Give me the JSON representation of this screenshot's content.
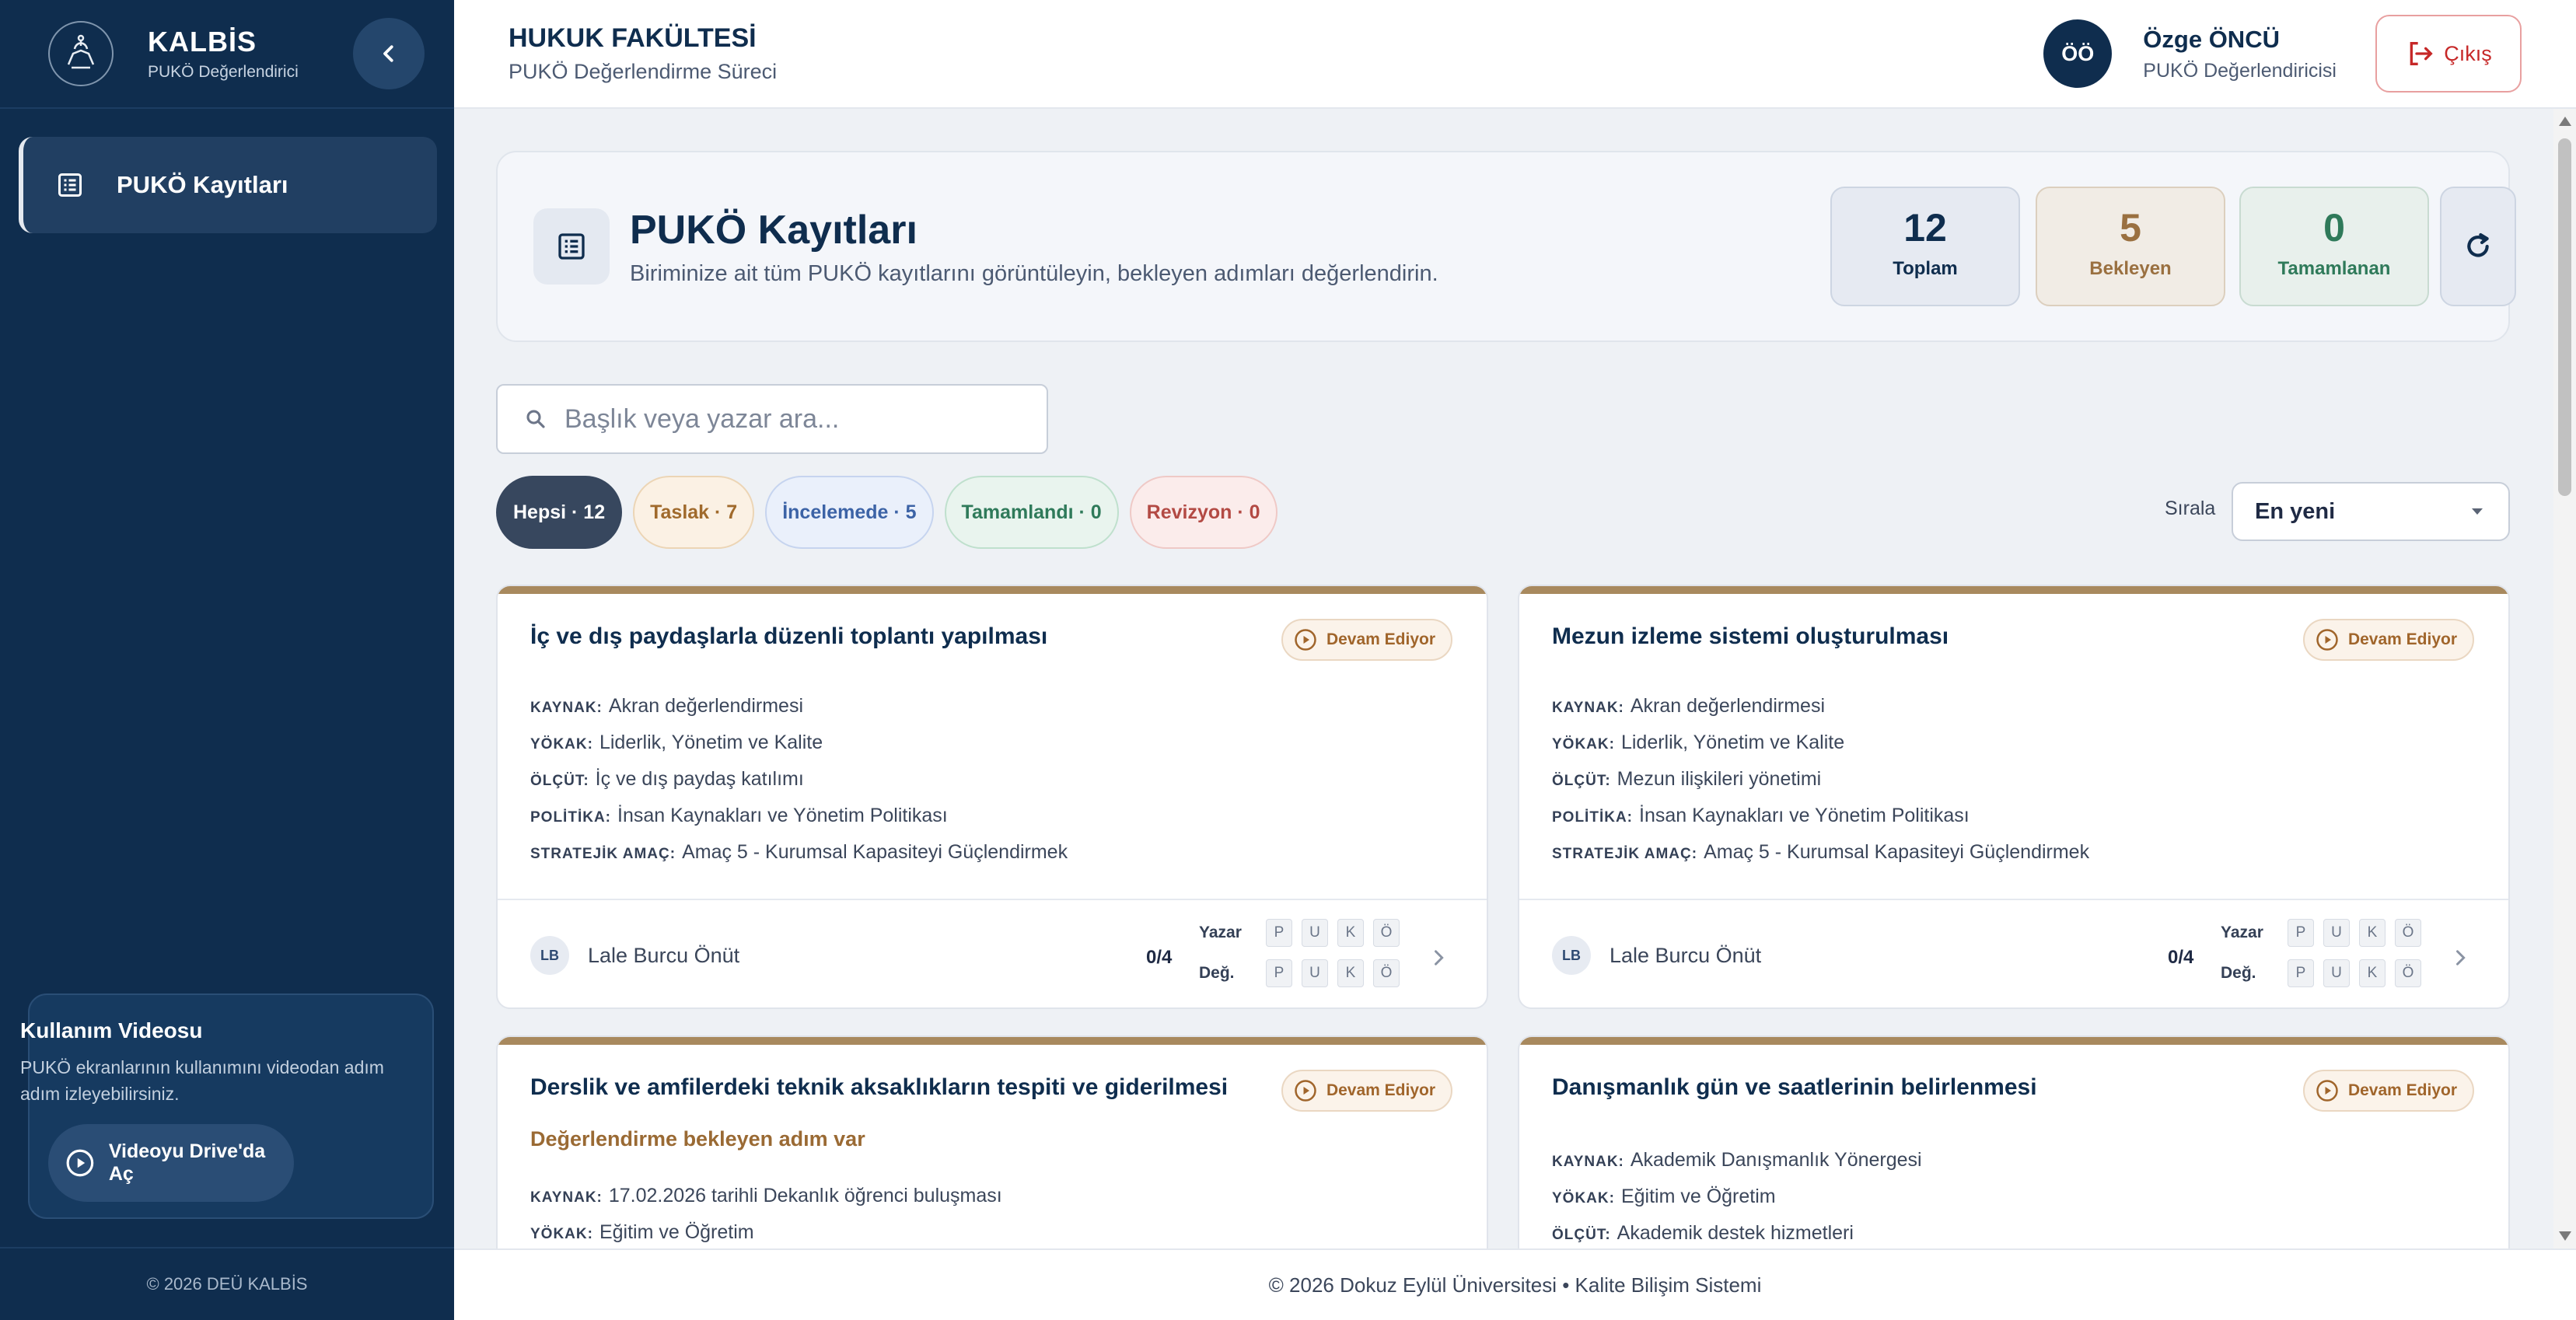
{
  "sidebar": {
    "brand_title": "KALBİS",
    "brand_sub": "PUKÖ Değerlendirici",
    "nav": [
      {
        "label": "PUKÖ Kayıtları",
        "icon": "list-icon"
      }
    ],
    "video": {
      "title": "Kullanım Videosu",
      "desc": "PUKÖ ekranlarının kullanımını videodan adım adım izleyebilirsiniz.",
      "button": "Videoyu Drive'da Aç"
    },
    "footer": "© 2026 DEÜ KALBİS"
  },
  "header": {
    "faculty": "HUKUK FAKÜLTESİ",
    "subtitle": "PUKÖ Değerlendirme Süreci",
    "user_initials": "ÖÖ",
    "user_name": "Özge ÖNCÜ",
    "user_role": "PUKÖ Değerlendiricisi",
    "logout": "Çıkış"
  },
  "hero": {
    "title": "PUKÖ Kayıtları",
    "desc": "Biriminize ait tüm PUKÖ kayıtlarını görüntüleyin, bekleyen adımları değerlendirin.",
    "stats": {
      "total": {
        "value": "12",
        "label": "Toplam"
      },
      "pending": {
        "value": "5",
        "label": "Bekleyen"
      },
      "done": {
        "value": "0",
        "label": "Tamamlanan"
      }
    }
  },
  "search": {
    "placeholder": "Başlık veya yazar ara..."
  },
  "filters": [
    "Hepsi · 12",
    "Taslak · 7",
    "İncelemede · 5",
    "Tamamlandı · 0",
    "Revizyon · 0"
  ],
  "sort": {
    "label": "Sırala",
    "value": "En yeni"
  },
  "meta_labels": {
    "source": "KAYNAK:",
    "yokak": "YÖKAK:",
    "criterion": "ÖLÇÜT:",
    "policy": "POLİTİKA:",
    "goal": "STRATEJİK AMAÇ:"
  },
  "cards": [
    {
      "title": "İç ve dış paydaşlarla düzenli toplantı yapılması",
      "status": "Devam Ediyor",
      "source": "Akran değerlendirmesi",
      "yokak": "Liderlik, Yönetim ve Kalite",
      "criterion": "İç ve dış paydaş katılımı",
      "policy": "İnsan Kaynakları ve Yönetim Politikası",
      "goal": "Amaç 5 - Kurumsal Kapasiteyi Güçlendirmek",
      "author_initials": "LB",
      "author": "Lale Burcu Önüt",
      "progress": "0/4"
    },
    {
      "title": "Mezun izleme sistemi oluşturulması",
      "status": "Devam Ediyor",
      "source": "Akran değerlendirmesi",
      "yokak": "Liderlik, Yönetim ve Kalite",
      "criterion": "Mezun ilişkileri yönetimi",
      "policy": "İnsan Kaynakları ve Yönetim Politikası",
      "goal": "Amaç 5 - Kurumsal Kapasiteyi Güçlendirmek",
      "author_initials": "LB",
      "author": "Lale Burcu Önüt",
      "progress": "0/4"
    },
    {
      "title": "Derslik ve amfilerdeki teknik aksaklıkların tespiti ve giderilmesi",
      "status": "Devam Ediyor",
      "pending_note": "Değerlendirme bekleyen adım var",
      "source": "17.02.2026 tarihli Dekanlık öğrenci buluşması",
      "yokak": "Eğitim ve Öğretim"
    },
    {
      "title": "Danışmanlık gün ve saatlerinin belirlenmesi",
      "status": "Devam Ediyor",
      "source": "Akademik Danışmanlık Yönergesi",
      "yokak": "Eğitim ve Öğretim",
      "criterion": "Akademik destek hizmetleri"
    }
  ],
  "puko": {
    "author_label": "Yazar",
    "eval_label": "Değ.",
    "letters": [
      "P",
      "U",
      "K",
      "Ö"
    ]
  },
  "footer": "© 2026 Dokuz Eylül Üniversitesi • Kalite Bilişim Sistemi",
  "colors": {
    "sidebar": "#0f2d4e",
    "accent": "#a8895e",
    "logout": "#c62828"
  }
}
